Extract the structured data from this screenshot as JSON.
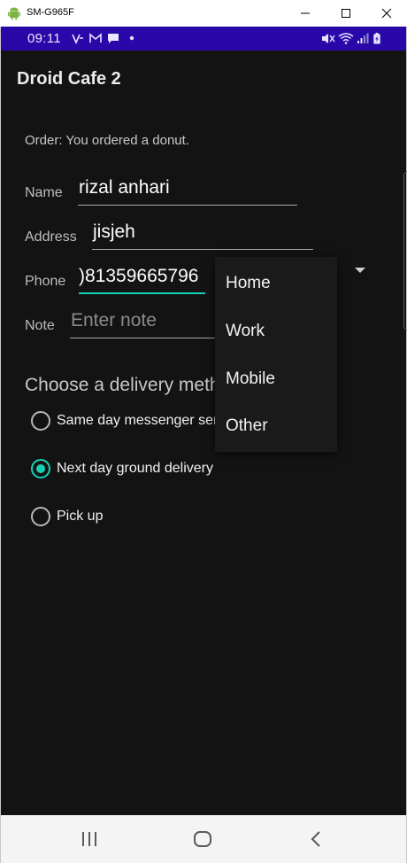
{
  "window": {
    "title": "SM-G965F"
  },
  "status_bar": {
    "time": "09:11"
  },
  "app": {
    "title": "Droid Cafe 2"
  },
  "order": {
    "text": "Order: You ordered a donut."
  },
  "form": {
    "name_label": "Name",
    "name_value": "rizal anhari",
    "address_label": "Address",
    "address_value": "jisjeh",
    "phone_label": "Phone",
    "phone_value": ")81359665796",
    "note_label": "Note",
    "note_placeholder": "Enter note"
  },
  "phone_type_dropdown": {
    "options": [
      "Home",
      "Work",
      "Mobile",
      "Other"
    ]
  },
  "delivery": {
    "heading": "Choose a delivery method",
    "options": [
      {
        "label": "Same day messenger service",
        "checked": false
      },
      {
        "label": "Next day ground delivery",
        "checked": true
      },
      {
        "label": "Pick up",
        "checked": false
      }
    ]
  },
  "colors": {
    "status_bar": "#2a07a8",
    "accent": "#16d1b5",
    "background": "#131313"
  },
  "icons": [
    "android-icon",
    "minimize-icon",
    "maximize-icon",
    "close-icon",
    "recents-icon",
    "home-icon",
    "back-icon"
  ]
}
